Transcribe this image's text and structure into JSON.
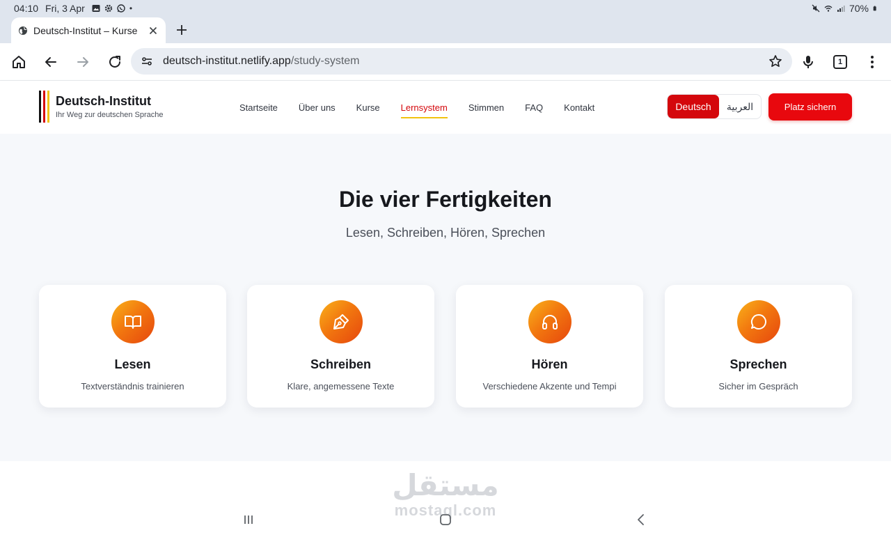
{
  "status_bar": {
    "time": "04:10",
    "date": "Fri, 3 Apr",
    "battery": "70%",
    "icons_left": [
      "image-icon",
      "gear-icon",
      "whatsapp-icon"
    ],
    "icons_right": [
      "mute-icon",
      "wifi-icon",
      "signal-icon",
      "battery-icon"
    ]
  },
  "browser": {
    "tab_title": "Deutsch-Institut – Kurse",
    "url_host": "deutsch-institut.netlify.app",
    "url_path": "/study-system",
    "tab_count": "1"
  },
  "site": {
    "brand_name": "Deutsch-Institut",
    "brand_tagline": "Ihr Weg zur deutschen Sprache",
    "flag_colors": [
      "#111111",
      "#d4070c",
      "#f2c20f"
    ],
    "nav": [
      {
        "label": "Startseite",
        "active": false
      },
      {
        "label": "Über uns",
        "active": false
      },
      {
        "label": "Kurse",
        "active": false
      },
      {
        "label": "Lernsystem",
        "active": true
      },
      {
        "label": "Stimmen",
        "active": false
      },
      {
        "label": "FAQ",
        "active": false
      },
      {
        "label": "Kontakt",
        "active": false
      }
    ],
    "lang_de": "Deutsch",
    "lang_ar": "العربية",
    "cta": "Platz sichern",
    "accent": "#d4070c"
  },
  "skills": {
    "title": "Die vier Fertigkeiten",
    "subtitle": "Lesen, Schreiben, Hören, Sprechen",
    "cards": [
      {
        "title": "Lesen",
        "desc": "Textverständnis trainieren",
        "icon": "book-icon"
      },
      {
        "title": "Schreiben",
        "desc": "Klare, angemessene Texte",
        "icon": "pen-icon"
      },
      {
        "title": "Hören",
        "desc": "Verschiedene Akzente und Tempi",
        "icon": "headphones-icon"
      },
      {
        "title": "Sprechen",
        "desc": "Sicher im Gespräch",
        "icon": "chat-bubble-icon"
      }
    ]
  },
  "watermark": {
    "arabic": "مستقل",
    "latin": "mostaql.com"
  }
}
